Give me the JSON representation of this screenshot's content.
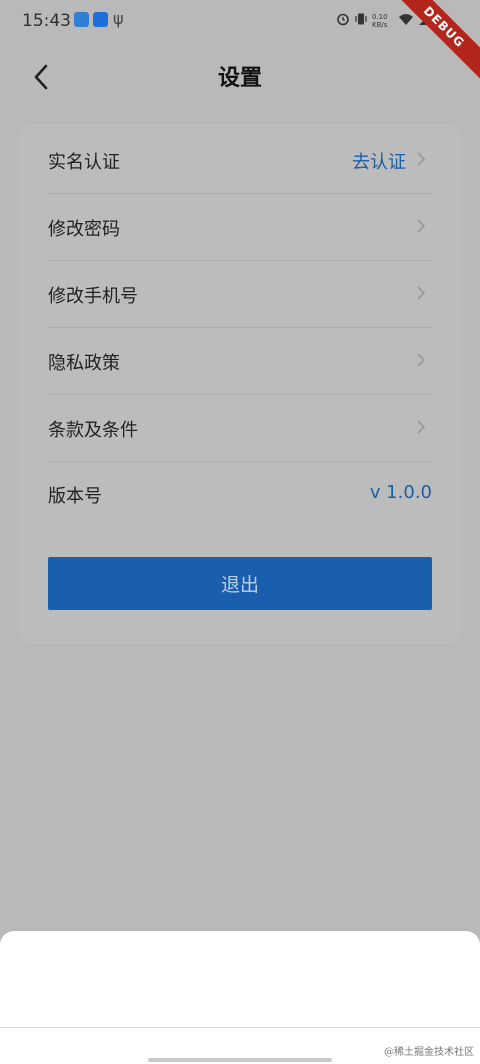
{
  "status_bar": {
    "time": "15:43",
    "left_icons": [
      "app-icon",
      "alipay-icon",
      "usb-icon"
    ],
    "right_icons": [
      "alarm-icon",
      "vibrate-icon",
      "wifi-icon",
      "signal-icon",
      "battery-icon"
    ],
    "network_speed": "0.10\nKB/s"
  },
  "debug_banner": "DEBUG",
  "header": {
    "title": "设置",
    "back_icon": "chevron-left-icon"
  },
  "settings": {
    "items": [
      {
        "label": "实名认证",
        "value": "去认证",
        "has_chevron": true
      },
      {
        "label": "修改密码",
        "value": "",
        "has_chevron": true
      },
      {
        "label": "修改手机号",
        "value": "",
        "has_chevron": true
      },
      {
        "label": "隐私政策",
        "value": "",
        "has_chevron": true
      },
      {
        "label": "条款及条件",
        "value": "",
        "has_chevron": true
      },
      {
        "label": "版本号",
        "value": "v 1.0.0",
        "has_chevron": false
      }
    ],
    "logout_label": "退出"
  },
  "colors": {
    "overlay_background": "#b9b9b9",
    "accent_blue": "#1a5fae",
    "link_blue": "#1a5fa6",
    "sheet_background": "#ffffff"
  },
  "watermark": "@稀土掘金技术社区"
}
